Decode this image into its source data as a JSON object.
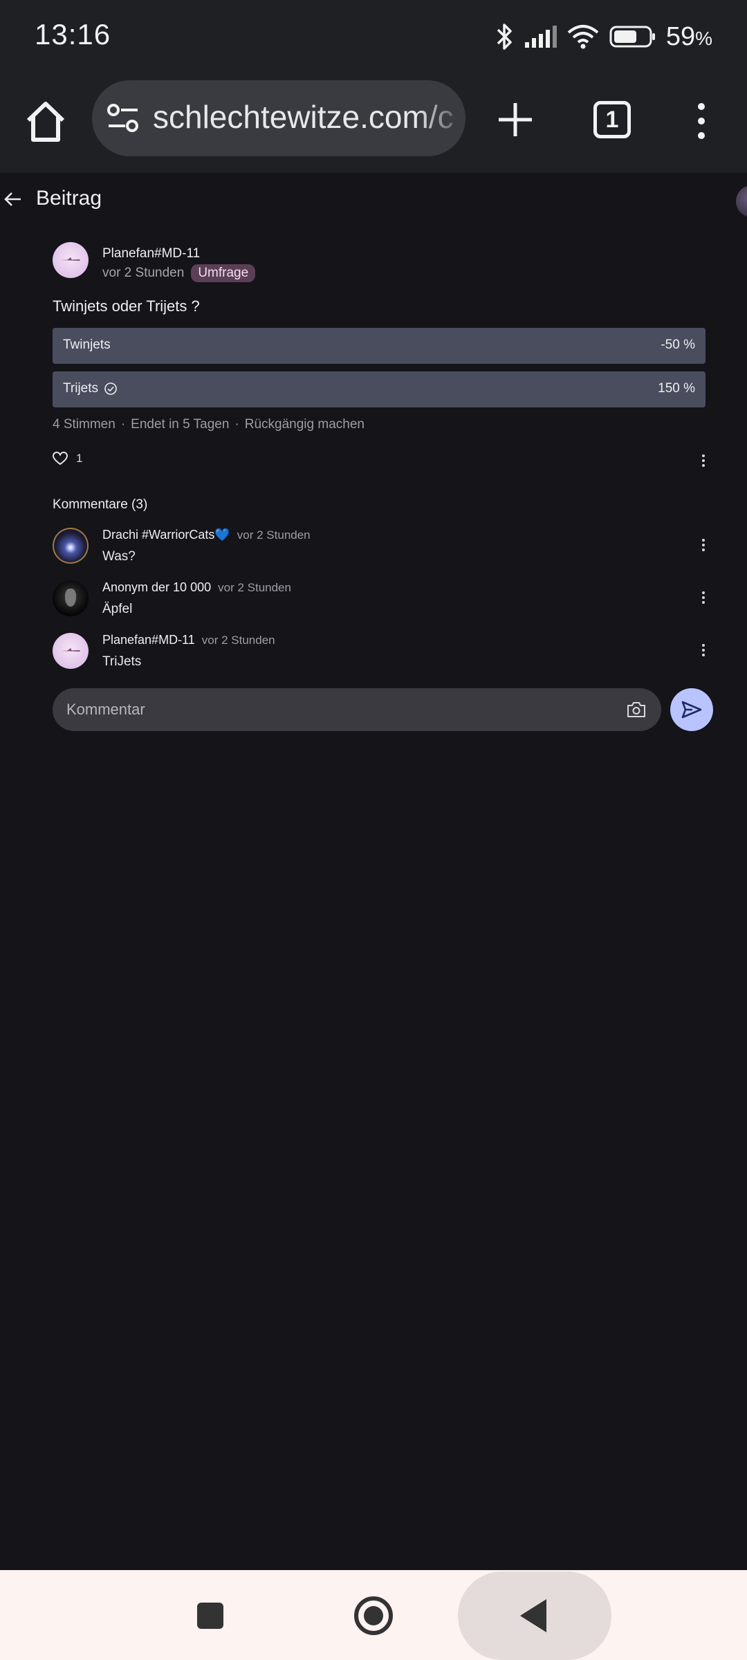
{
  "status_bar": {
    "time": "13:16",
    "battery_percent": "59",
    "battery_unit": "%"
  },
  "browser": {
    "url": "schlechtewitze.com/c",
    "tab_count": "1"
  },
  "page": {
    "title": "Beitrag"
  },
  "post": {
    "author": "Planefan#MD-11",
    "time": "vor 2 Stunden",
    "badge": "Umfrage",
    "question": "Twinjets oder Trijets ?",
    "options": [
      {
        "label": "Twinjets",
        "percent": "-50 %",
        "value": -50,
        "selected": false
      },
      {
        "label": "Trijets",
        "percent": "150 %",
        "value": 150,
        "selected": true
      }
    ],
    "votes": "4 Stimmen",
    "ends": "Endet in 5 Tagen",
    "undo": "Rückgängig machen",
    "likes": "1"
  },
  "comments": {
    "title": "Kommentare (3)",
    "items": [
      {
        "author": "Drachi #WarriorCats💙",
        "time": "vor 2 Stunden",
        "text": "Was?"
      },
      {
        "author": "Anonym der 10 000",
        "time": "vor 2 Stunden",
        "text": "Äpfel"
      },
      {
        "author": "Planefan#MD-11",
        "time": "vor 2 Stunden",
        "text": "TriJets"
      }
    ],
    "input_placeholder": "Kommentar"
  },
  "colors": {
    "background": "#141419",
    "accent": "#b9c4ff",
    "badge": "#5a3f56",
    "poll_bar": "#4a4d5e"
  }
}
